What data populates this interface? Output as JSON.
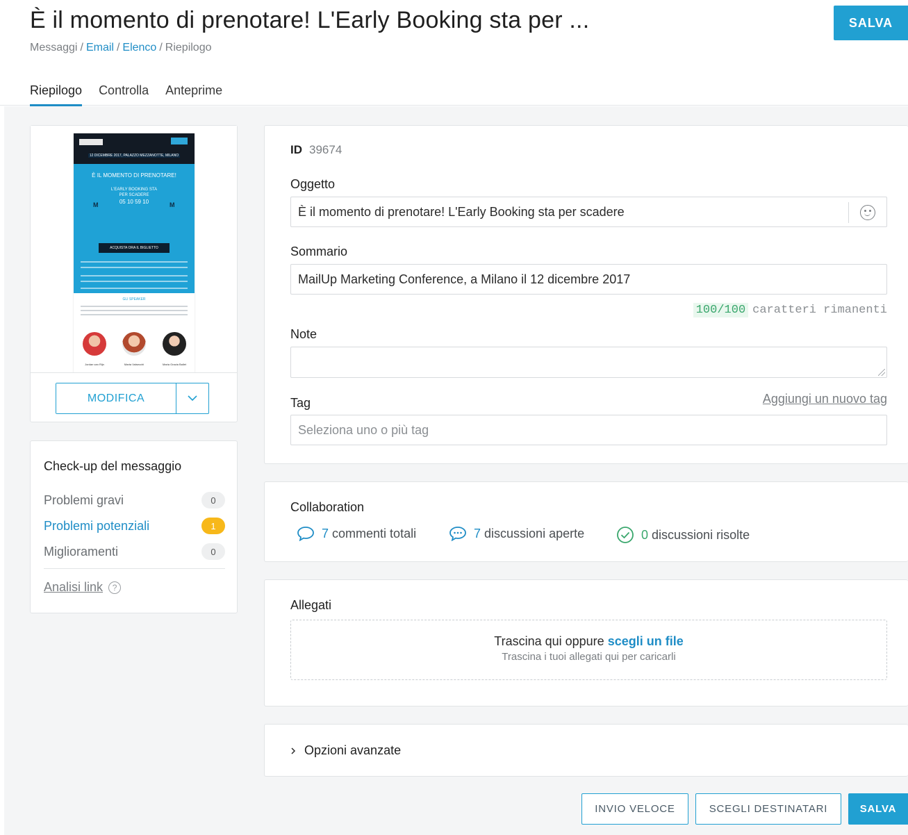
{
  "header": {
    "title": "È il momento di prenotare! L'Early Booking sta per ...",
    "save_label": "SALVA",
    "breadcrumb": [
      "Messaggi",
      "Email",
      "Elenco",
      "Riepilogo"
    ],
    "breadcrumb_separator": "/"
  },
  "tabs": [
    {
      "label": "Riepilogo",
      "active": true
    },
    {
      "label": "Controlla",
      "active": false
    },
    {
      "label": "Anteprime",
      "active": false
    }
  ],
  "preview": {
    "email": {
      "date_line": "12 DICEMBRE 2017, PALAZZO MEZZANOTTE, MILANO",
      "hero_title": "È IL MOMENTO DI PRENOTARE!",
      "countdown_caption": "L'EARLY BOOKING STA PER SCADERE",
      "countdown": "05 10 59 10",
      "cta": "ACQUISTA ORA IL BIGLIETTO",
      "speakers_title": "GLI SPEAKER",
      "speakers": [
        "Jordan van Rijn",
        "Marta Valsecchi",
        "Maria Grazia Ballet"
      ]
    },
    "edit_label": "MODIFICA"
  },
  "checkup": {
    "title": "Check-up del messaggio",
    "rows": [
      {
        "label": "Problemi gravi",
        "count": "0",
        "highlight": false
      },
      {
        "label": "Problemi potenziali",
        "count": "1",
        "highlight": true
      },
      {
        "label": "Miglioramenti",
        "count": "0",
        "highlight": false
      }
    ],
    "link_analysis": "Analisi link",
    "help_glyph": "?"
  },
  "form": {
    "id_label": "ID",
    "id_value": "39674",
    "subject_label": "Oggetto",
    "subject_value": "È il momento di prenotare! L'Early Booking sta per scadere",
    "summary_label": "Sommario",
    "summary_value": "MailUp Marketing Conference, a Milano il 12 dicembre 2017",
    "char_count": "100/100",
    "char_count_suffix": "caratteri rimanenti",
    "notes_label": "Note",
    "notes_value": "",
    "tag_label": "Tag",
    "add_tag_link": "Aggiungi un nuovo tag",
    "tag_placeholder": "Seleziona uno o più tag"
  },
  "collaboration": {
    "title": "Collaboration",
    "items": [
      {
        "count": "7",
        "label": "commenti totali",
        "icon": "comment-icon"
      },
      {
        "count": "7",
        "label": "discussioni aperte",
        "icon": "discussion-icon"
      },
      {
        "count": "0",
        "label": "discussioni risolte",
        "icon": "check-circle-icon"
      }
    ]
  },
  "attachments": {
    "title": "Allegati",
    "drop_text": "Trascina qui oppure",
    "choose_file": "scegli un file",
    "drop_hint": "Trascina i tuoi allegati qui per caricarli"
  },
  "advanced": {
    "label": "Opzioni avanzate"
  },
  "footer": {
    "quick_send": "INVIO VELOCE",
    "choose_recipients": "SCEGLI DESTINATARI",
    "save": "SALVA"
  },
  "colors": {
    "accent": "#21a0d2",
    "link": "#1f8dc6",
    "warning": "#f7b81a",
    "success": "#3aa76d"
  }
}
